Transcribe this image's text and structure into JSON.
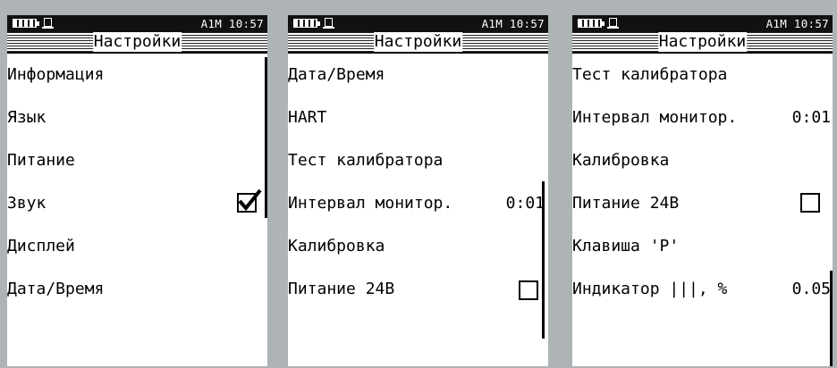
{
  "colors": {
    "statusbar": "#111111",
    "accent_decoration": "#f2b04a",
    "background": "#aeb3b6"
  },
  "screens": [
    {
      "status": {
        "icons": [
          "battery-icon",
          "memory-card-icon"
        ],
        "text": "A1M 10:57"
      },
      "title": "Настройки",
      "items": [
        {
          "label": "Информация"
        },
        {
          "label": "Язык"
        },
        {
          "label": "Питание"
        },
        {
          "label": "Звук",
          "checkbox": true
        },
        {
          "label": "Дисплей"
        },
        {
          "label": "Дата/Время"
        }
      ]
    },
    {
      "status": {
        "icons": [
          "battery-icon",
          "memory-card-icon"
        ],
        "text": "A1M 10:57"
      },
      "title": "Настройки",
      "items": [
        {
          "label": "Дата/Время"
        },
        {
          "label": "HART"
        },
        {
          "label": "Тест калибратора"
        },
        {
          "label": "Интервал монитор.",
          "value": "0:01"
        },
        {
          "label": "Калибровка"
        },
        {
          "label": "Питание 24В",
          "checkbox": false
        }
      ]
    },
    {
      "status": {
        "icons": [
          "battery-icon",
          "memory-card-icon"
        ],
        "text": "A1M 10:57"
      },
      "title": "Настройки",
      "items": [
        {
          "label": "Тест калибратора"
        },
        {
          "label": "Интервал монитор.",
          "value": "0:01"
        },
        {
          "label": "Калибровка"
        },
        {
          "label": "Питание 24В",
          "checkbox": false
        },
        {
          "label": "Клавиша 'P'"
        },
        {
          "label": "Индикатор |||, %",
          "value": "0.05"
        }
      ]
    }
  ]
}
